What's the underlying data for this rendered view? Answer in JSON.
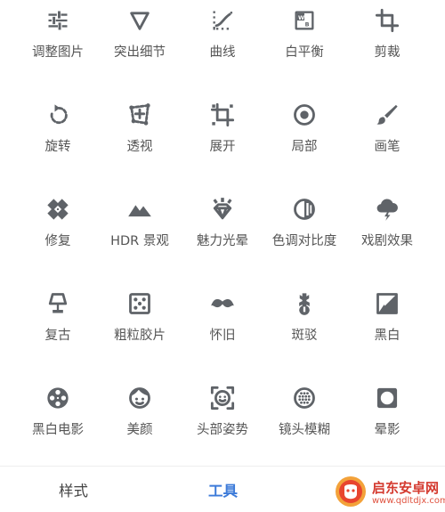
{
  "tools": [
    {
      "label": "调整图片",
      "icon": "tune-sliders-icon"
    },
    {
      "label": "突出细节",
      "icon": "details-triangle-icon"
    },
    {
      "label": "曲线",
      "icon": "curves-icon"
    },
    {
      "label": "白平衡",
      "icon": "white-balance-icon"
    },
    {
      "label": "剪裁",
      "icon": "crop-icon"
    },
    {
      "label": "旋转",
      "icon": "rotate-icon"
    },
    {
      "label": "透视",
      "icon": "perspective-icon"
    },
    {
      "label": "展开",
      "icon": "expand-icon"
    },
    {
      "label": "局部",
      "icon": "selective-target-icon"
    },
    {
      "label": "画笔",
      "icon": "brush-icon"
    },
    {
      "label": "修复",
      "icon": "healing-bandage-icon"
    },
    {
      "label": "HDR 景观",
      "icon": "mountains-icon"
    },
    {
      "label": "魅力光晕",
      "icon": "glamour-diamond-icon"
    },
    {
      "label": "色调对比度",
      "icon": "tonal-contrast-icon"
    },
    {
      "label": "戏剧效果",
      "icon": "drama-cloud-icon"
    },
    {
      "label": "复古",
      "icon": "vintage-lamp-icon"
    },
    {
      "label": "粗粒胶片",
      "icon": "grainy-film-dice-icon"
    },
    {
      "label": "怀旧",
      "icon": "mustache-icon"
    },
    {
      "label": "斑驳",
      "icon": "grunge-guitar-icon"
    },
    {
      "label": "黑白",
      "icon": "black-white-photo-icon"
    },
    {
      "label": "黑白电影",
      "icon": "film-reel-icon"
    },
    {
      "label": "美颜",
      "icon": "face-icon"
    },
    {
      "label": "头部姿势",
      "icon": "face-frame-icon"
    },
    {
      "label": "镜头模糊",
      "icon": "lens-blur-icon"
    },
    {
      "label": "晕影",
      "icon": "vignette-icon"
    }
  ],
  "tabs": {
    "styles_label": "样式",
    "tools_label": "工具",
    "active_color": "#3d7bd9"
  },
  "watermark": {
    "text": "启东安卓网",
    "url": "www.qdltdjx.com"
  }
}
